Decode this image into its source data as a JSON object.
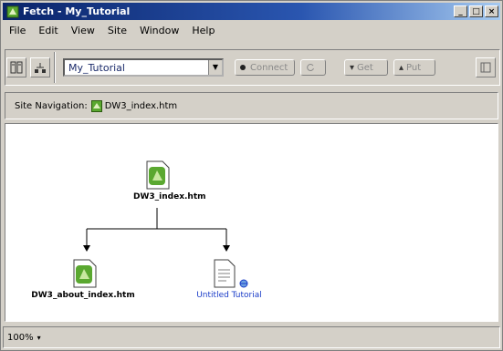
{
  "window": {
    "title": "Fetch - My_Tutorial"
  },
  "menu": [
    "File",
    "Edit",
    "View",
    "Site",
    "Window",
    "Help"
  ],
  "toolbar": {
    "site_select": "My_Tutorial",
    "connect_label": "Connect",
    "get_label": "Get",
    "put_label": "Put"
  },
  "site_navigation": {
    "label": "Site Navigation:",
    "home_page": "DW3_index.htm"
  },
  "site_map": {
    "root": {
      "label": "DW3_index.htm"
    },
    "children": [
      {
        "label": "DW3_about_index.htm",
        "link": false
      },
      {
        "label": "Untitled Tutorial",
        "link": true
      }
    ]
  },
  "status": {
    "zoom": "100%"
  },
  "colors": {
    "titlebar": "#0a246a",
    "link": "#1a3cc8",
    "page_icon": "#5aa830"
  }
}
